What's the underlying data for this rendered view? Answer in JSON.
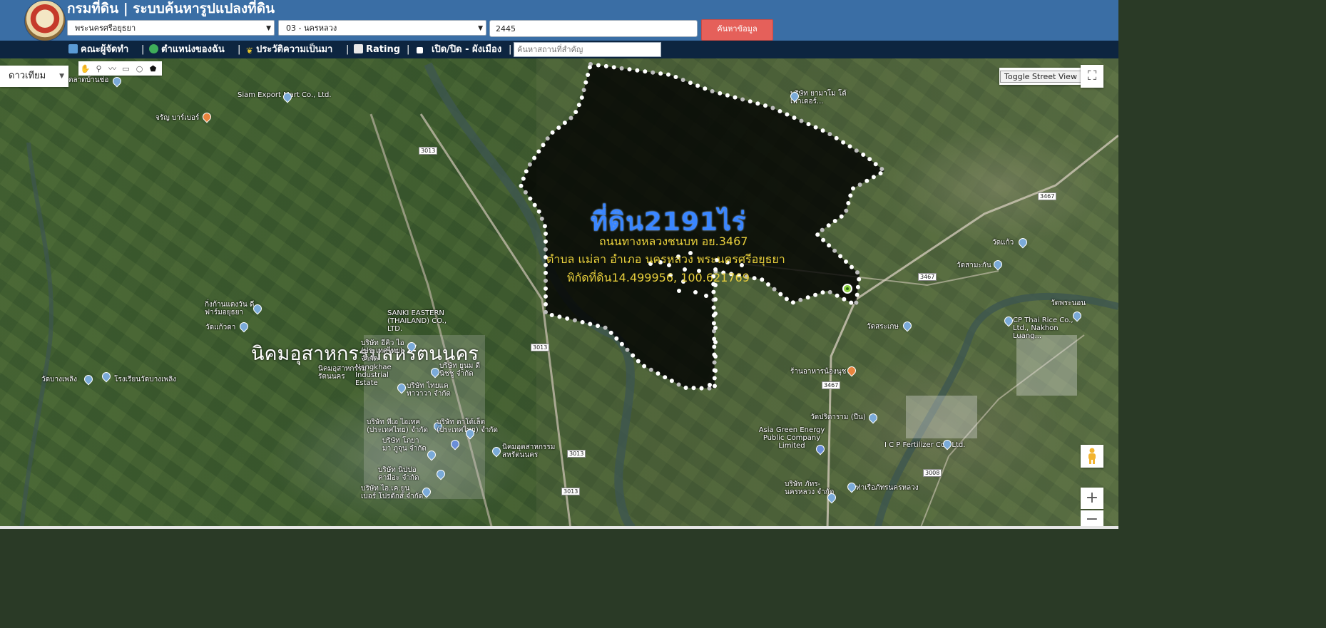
{
  "header": {
    "title": "กรมที่ดิน | ระบบค้นหารูปแปลงที่ดิน",
    "province": "พระนครศรีอยุธยา",
    "district": "03 - นครหลวง",
    "parcel_number": "2445",
    "search_label": "ค้นหาข้อมูล"
  },
  "nav": {
    "items": [
      {
        "label": "คณะผู้จัดทำ",
        "icon": "building-icon",
        "color": "#5b9bd5"
      },
      {
        "label": "ตำแหน่งของฉัน",
        "icon": "globe-icon",
        "color": "#3fae5a"
      },
      {
        "label": "ประวัติความเป็นมา",
        "icon": "sprout-icon",
        "color": "#e6c229"
      },
      {
        "label": "Rating",
        "icon": "chart-icon",
        "color": "#e8e8e8"
      },
      {
        "label": "เปิด/ปิด - ผังเมือง",
        "icon": "checkbox-icon",
        "color": "#ffffff"
      }
    ],
    "places_placeholder": "ค้นหาสถานที่สำคัญ"
  },
  "map": {
    "map_type": "ดาวเทียม",
    "street_view_label": "Toggle Street View",
    "estate_label": "นิคมอุสาหกรรมสหรัตนนคร",
    "overlay": {
      "size": "ที่ดิน2191ไร่",
      "road": "ถนนทางหลวงชนบท อย.3467",
      "location": "ตำบล แม่ลา อำเภอ นครหลวง พระนครศรีอยุธยา",
      "coords": "พิกัดที่ดิน14.499956, 100.621769"
    },
    "colors": {
      "header": "#3a6ea5",
      "nav": "#0d2540",
      "search_button": "#e5605a",
      "land_size": "#3a86ff",
      "land_text": "#e8cf3c"
    },
    "pois": [
      "ตลาดบ้านช่อ",
      "Siam Export Mart Co., Ltd.",
      "จรัญ บาร์เบอร์",
      "บริษัท ยามาโม โต้ เพาเดอร์...",
      "กิ่งก้านแตงวัน ดีฟาร์มอยุธยา",
      "วัดแก้วดา",
      "SANKI EASTERN (THAILAND) CO., LTD.",
      "บริษัท อีคิว ไอ (ประเทศไทย) จำกัด",
      "Nongkhae Industrial Estate",
      "บริษัท ยูนม ดี นิชชู จำกัด",
      "บริษัท ไทยแค ทาวาวา จำกัด",
      "วัดบางเพลิง",
      "โรงเรียนวัดบางเพลิง",
      "นิคมอุสาหกรรม รัตนนคร",
      "บริษัท ทีเอ ไอเทค (ประเทศไทย) จำกัด",
      "บริษัท ดาโต้เล็ต (ประเทศไทย) จำกัด",
      "บริษัท โภยามา ภูจุน จำกัด",
      "นิคมอุตสาหกรรม สหรัตนนคร",
      "บริษัท นิปปอ คามีอะ จำกัด",
      "บริษัท ไอ.เค.ยูน เบอร์ โปรดักส์ จำกัด",
      "วัดแก้ว",
      "วัดสามะกัน",
      "วัดพระนอน",
      "CP Thai Rice Co., Ltd., Nakhon Luang...",
      "วัดสระเกษ",
      "ร้านอาหารน้องนุช",
      "วัดปริดาราม (ปืน)",
      "Asia Green Energy Public Company Limited",
      "I C P Fertilizer Co., Ltd.",
      "ท่าเรือภัทรนครหลวง",
      "บริษัท ภัทร-นครหลวง จำกัด"
    ],
    "road_shields": [
      "3013",
      "3013",
      "3013",
      "3013",
      "3467",
      "3467",
      "3467",
      "3008"
    ]
  }
}
